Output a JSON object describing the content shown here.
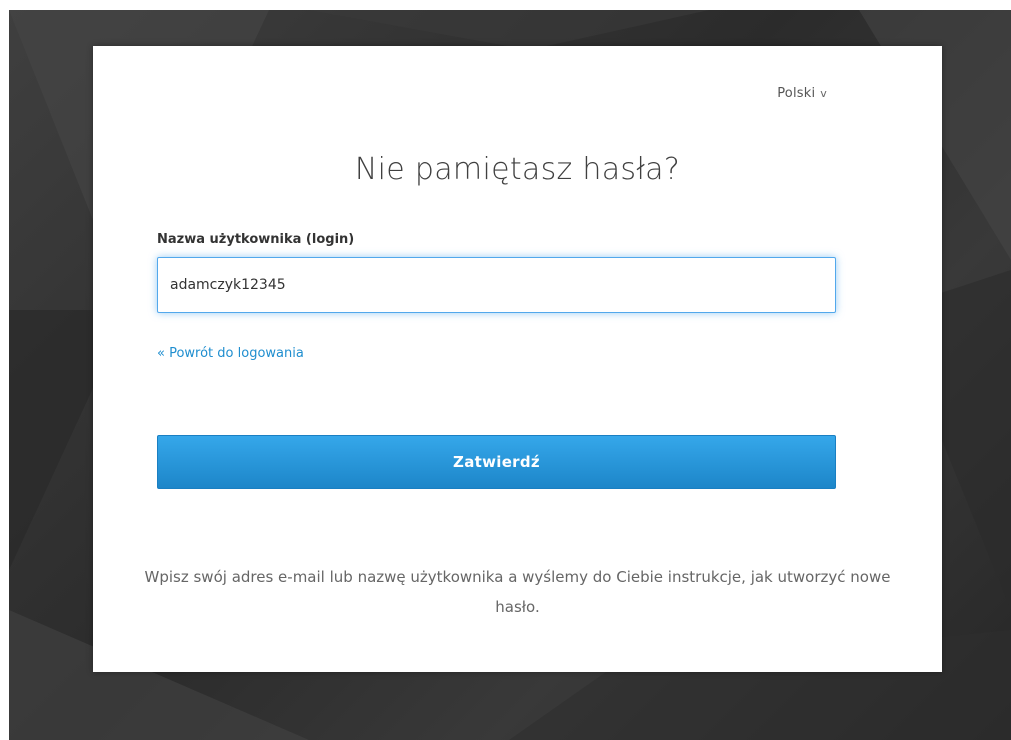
{
  "language_selector": {
    "label": "Polski",
    "chevron": "v"
  },
  "form": {
    "title": "Nie pamiętasz hasła?",
    "username_label": "Nazwa użytkownika (login)",
    "username_value": "adamczyk12345",
    "back_link": "« Powrót do logowania",
    "submit_label": "Zatwierdź",
    "help_text": "Wpisz swój adres e-mail lub nazwę użytkownika a wyślemy do Ciebie instrukcje, jak utworzyć nowe hasło."
  },
  "colors": {
    "accent": "#1f8ecf",
    "button": "#2896dc",
    "focus_border": "#52a8ec",
    "background": "#333333"
  }
}
